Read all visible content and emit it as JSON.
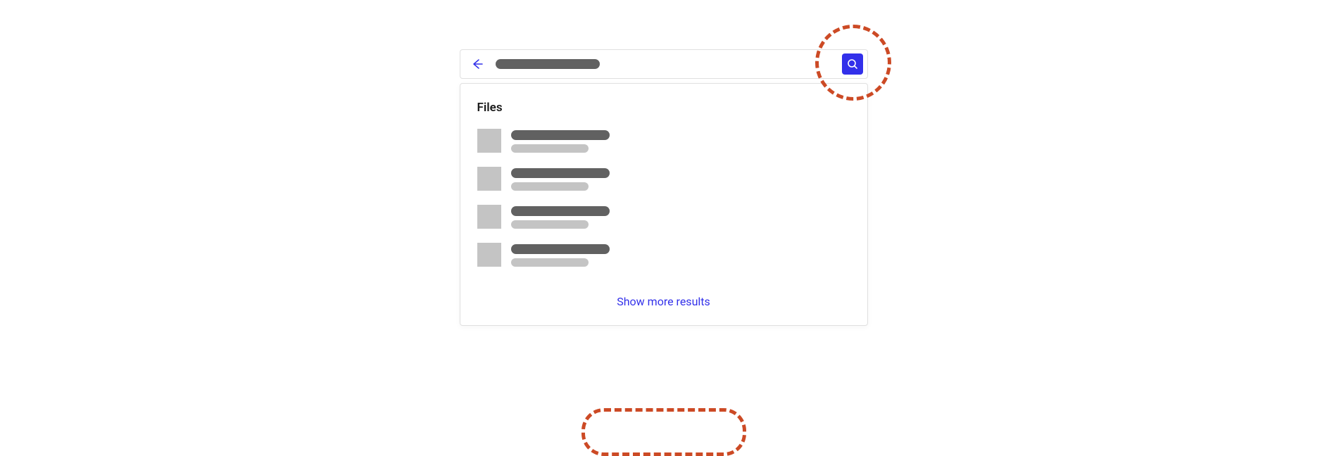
{
  "section_title": "Files",
  "show_more_label": "Show more results",
  "file_items": [
    {
      "thumb": "placeholder",
      "title": "placeholder",
      "subtitle": "placeholder"
    },
    {
      "thumb": "placeholder",
      "title": "placeholder",
      "subtitle": "placeholder"
    },
    {
      "thumb": "placeholder",
      "title": "placeholder",
      "subtitle": "placeholder"
    },
    {
      "thumb": "placeholder",
      "title": "placeholder",
      "subtitle": "placeholder"
    }
  ],
  "colors": {
    "accent": "#3230ea",
    "highlight": "#cc4a25"
  }
}
